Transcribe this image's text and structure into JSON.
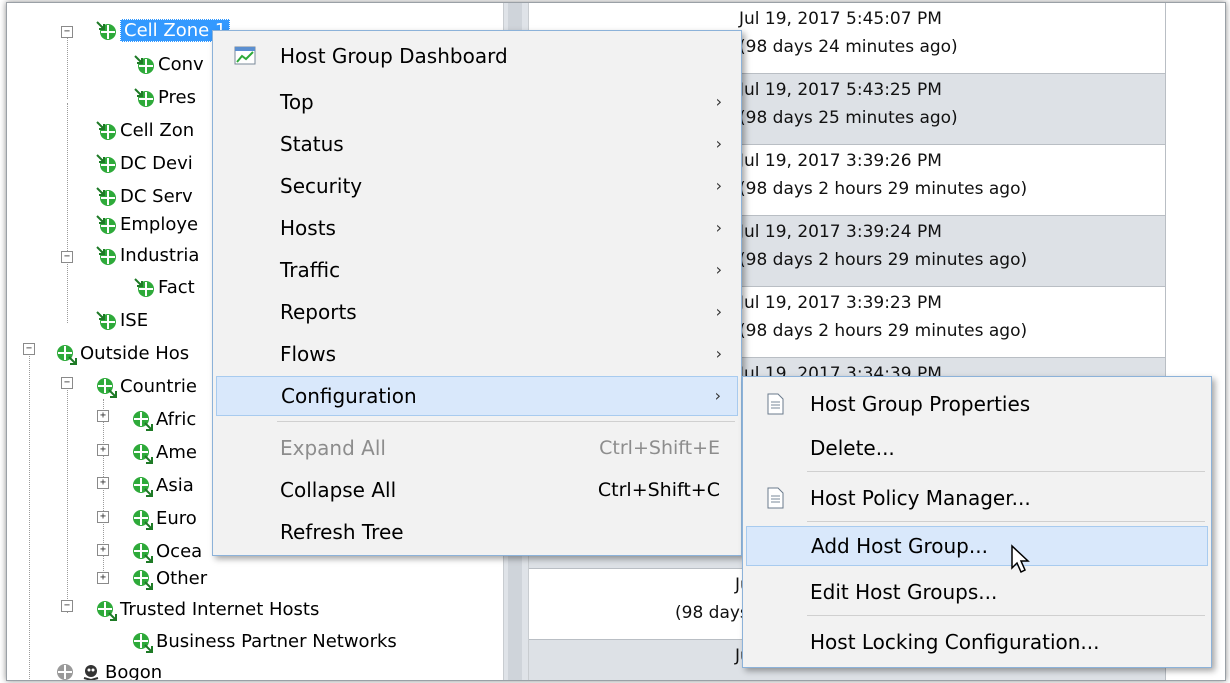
{
  "tree": {
    "items": [
      {
        "label": "Cell Zone 1"
      },
      {
        "label": "Conv"
      },
      {
        "label": "Pres"
      },
      {
        "label": "Cell Zon"
      },
      {
        "label": "DC Devi"
      },
      {
        "label": "DC Serv"
      },
      {
        "label": "Employe"
      },
      {
        "label": "Industria"
      },
      {
        "label": "Fact"
      },
      {
        "label": "ISE"
      },
      {
        "label": "Outside Hos"
      },
      {
        "label": "Countrie"
      },
      {
        "label": "Afric"
      },
      {
        "label": "Ame"
      },
      {
        "label": "Asia"
      },
      {
        "label": "Euro"
      },
      {
        "label": "Ocea"
      },
      {
        "label": "Other"
      },
      {
        "label": "Trusted Internet Hosts"
      },
      {
        "label": "Business Partner Networks"
      },
      {
        "label": "Bogon"
      }
    ]
  },
  "table": {
    "rows": [
      {
        "line1": "Jul 19, 2017 5:45:07 PM",
        "line2": "(98 days 24 minutes ago)"
      },
      {
        "line1": "Jul 19, 2017 5:43:25 PM",
        "line2": "(98 days 25 minutes ago)"
      },
      {
        "line1": "Jul 19, 2017 3:39:26 PM",
        "line2": "(98 days 2 hours 29 minutes ago)"
      },
      {
        "line1": "Jul 19, 2017 3:39:24 PM",
        "line2": "(98 days 2 hours 29 minutes ago)"
      },
      {
        "line1": "Jul 19, 2017 3:39:23 PM",
        "line2": "(98 days 2 hours 29 minutes ago)"
      },
      {
        "line1": "Jul 19, 2017 3:34:39 PM",
        "line2": ""
      },
      {
        "line1": "Jul",
        "line2": "(98 days"
      },
      {
        "line1": "Jul",
        "line2": ""
      }
    ]
  },
  "context_menu": {
    "items": [
      {
        "label": "Host Group Dashboard"
      },
      {
        "label": "Top"
      },
      {
        "label": "Status"
      },
      {
        "label": "Security"
      },
      {
        "label": "Hosts"
      },
      {
        "label": "Traffic"
      },
      {
        "label": "Reports"
      },
      {
        "label": "Flows"
      },
      {
        "label": "Configuration"
      },
      {
        "label": "Expand All",
        "shortcut": "Ctrl+Shift+E"
      },
      {
        "label": "Collapse All",
        "shortcut": "Ctrl+Shift+C"
      },
      {
        "label": "Refresh Tree"
      }
    ],
    "submenu_arrow": "›"
  },
  "submenu": {
    "items": [
      {
        "label": "Host Group Properties"
      },
      {
        "label": "Delete..."
      },
      {
        "label": "Host Policy Manager..."
      },
      {
        "label": "Add Host Group..."
      },
      {
        "label": "Edit Host Groups..."
      },
      {
        "label": "Host Locking Configuration..."
      }
    ]
  },
  "colors": {
    "selection": "#3399ff",
    "menu_highlight": "#d9e8fb",
    "alt_row": "#dde1e6",
    "node_icon_green": "#2eaa3a"
  },
  "icons": {
    "inside_group": "host-group-inside-icon",
    "outside_group": "host-group-outside-icon",
    "bogon": "skull-icon",
    "dashboard": "chart-icon",
    "document": "document-icon",
    "cursor": "mouse-pointer-icon"
  }
}
